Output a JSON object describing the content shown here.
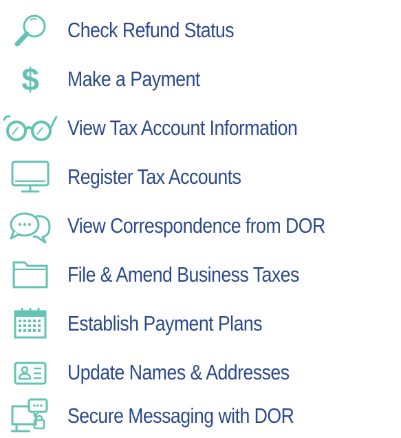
{
  "menu": {
    "accent_color": "#62c3b3",
    "text_color": "#2a4a8c",
    "items": [
      {
        "label": "Check Refund Status",
        "icon": "magnifier-icon"
      },
      {
        "label": "Make a Payment",
        "icon": "dollar-icon",
        "glyph": "$"
      },
      {
        "label": "View Tax Account Information",
        "icon": "glasses-icon"
      },
      {
        "label": "Register Tax Accounts",
        "icon": "monitor-icon"
      },
      {
        "label": "View Correspondence from DOR",
        "icon": "chat-bubbles-icon"
      },
      {
        "label": "File & Amend Business Taxes",
        "icon": "folder-icon"
      },
      {
        "label": "Establish Payment Plans",
        "icon": "calendar-icon"
      },
      {
        "label": "Update Names & Addresses",
        "icon": "id-card-icon"
      },
      {
        "label": "Secure Messaging with DOR",
        "icon": "secure-message-icon"
      }
    ]
  }
}
